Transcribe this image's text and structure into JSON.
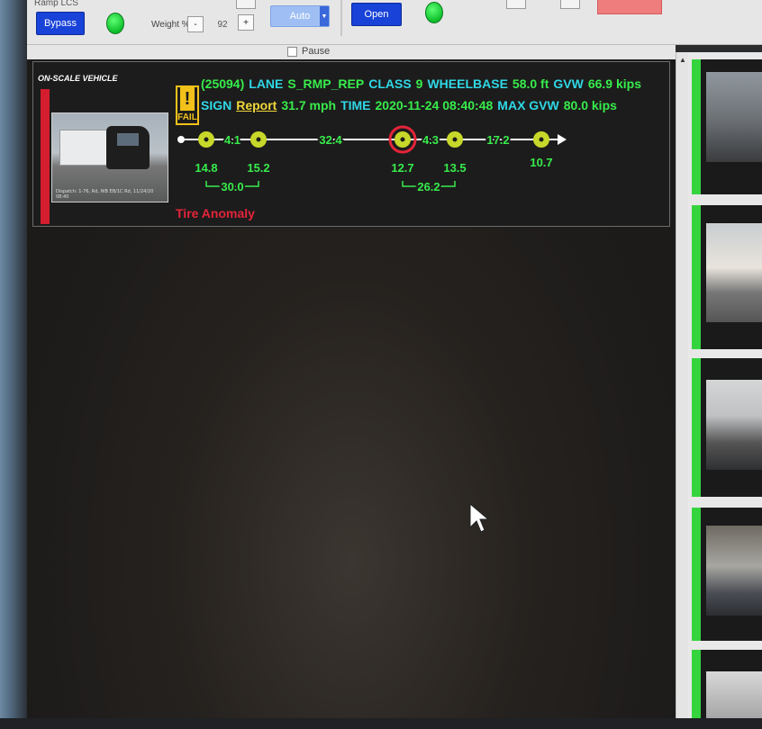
{
  "toolbar": {
    "ramp_label": "Ramp LCS",
    "bypass_label": "Bypass",
    "weight_label": "Weight %",
    "weight_minus": "-",
    "weight_value": "92",
    "weight_plus": "+",
    "auto_label": "Auto",
    "open_label": "Open",
    "pause_label": "Pause"
  },
  "vehicle": {
    "panel_title": "ON-SCALE VEHICLE",
    "fail_label": "FAIL",
    "id": "(25094)",
    "lane_label": "LANE",
    "lane_value": "S_RMP_REP",
    "class_label": "CLASS",
    "class_value": "9",
    "wheelbase_label": "WHEELBASE",
    "wheelbase_value": "58.0 ft",
    "gvw_label": "GVW",
    "gvw_value": "66.9 kips",
    "sign_label": "SIGN",
    "report_label": "Report",
    "speed_value": "31.7 mph",
    "time_label": "TIME",
    "time_value": "2020-11-24 08:40:48",
    "max_gvw_label": "MAX GVW",
    "max_gvw_value": "80.0 kips",
    "spacings": [
      "4.1",
      "32.4",
      "4.3",
      "17.2"
    ],
    "axle_weights": [
      "14.8",
      "15.2",
      "12.7",
      "13.5",
      "10.7"
    ],
    "group_weights": [
      "30.0",
      "26.2"
    ],
    "anomaly_text": "Tire Anomaly",
    "thumb_caption": "Dispatch: 1-76, Rd, WB EB/1C Rd, 11/24/20 08:40"
  },
  "colors": {
    "label_cyan": "#2fd8e6",
    "value_green": "#37ec4c",
    "alert_red": "#e4243a",
    "axle_yellow": "#c8d82a",
    "fail_yellow": "#f2c21b"
  }
}
